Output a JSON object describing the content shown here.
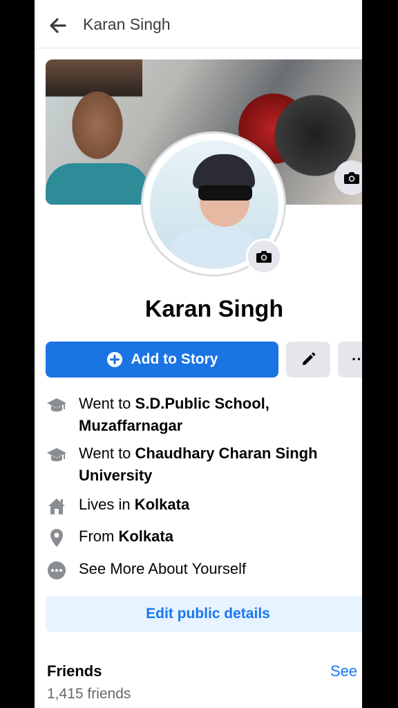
{
  "header": {
    "title": "Karan Singh",
    "back_icon": "arrow-left-icon"
  },
  "profile": {
    "name": "Karan Singh",
    "cover_camera_icon": "camera-icon",
    "avatar_camera_icon": "camera-icon"
  },
  "actions": {
    "add_story_label": "Add to Story",
    "add_story_icon": "plus-circle-icon",
    "edit_icon": "pencil-icon",
    "more_label": "··"
  },
  "details": [
    {
      "icon": "graduation-cap-icon",
      "prefix": "Went to ",
      "bold": "S.D.Public School, Muzaffarnagar"
    },
    {
      "icon": "graduation-cap-icon",
      "prefix": "Went to ",
      "bold": "Chaudhary Charan Singh University"
    },
    {
      "icon": "home-icon",
      "prefix": "Lives in ",
      "bold": "Kolkata"
    },
    {
      "icon": "location-pin-icon",
      "prefix": "From ",
      "bold": "Kolkata"
    },
    {
      "icon": "more-dots-icon",
      "prefix": "See More About Yourself",
      "bold": ""
    }
  ],
  "edit_public_label": "Edit public details",
  "friends": {
    "title": "Friends",
    "see_label": "See",
    "count": "1,415 friends"
  },
  "colors": {
    "primary": "#1b74e4",
    "link": "#1877f2",
    "button_gray": "#e4e6eb",
    "light_blue": "#e7f3ff"
  }
}
